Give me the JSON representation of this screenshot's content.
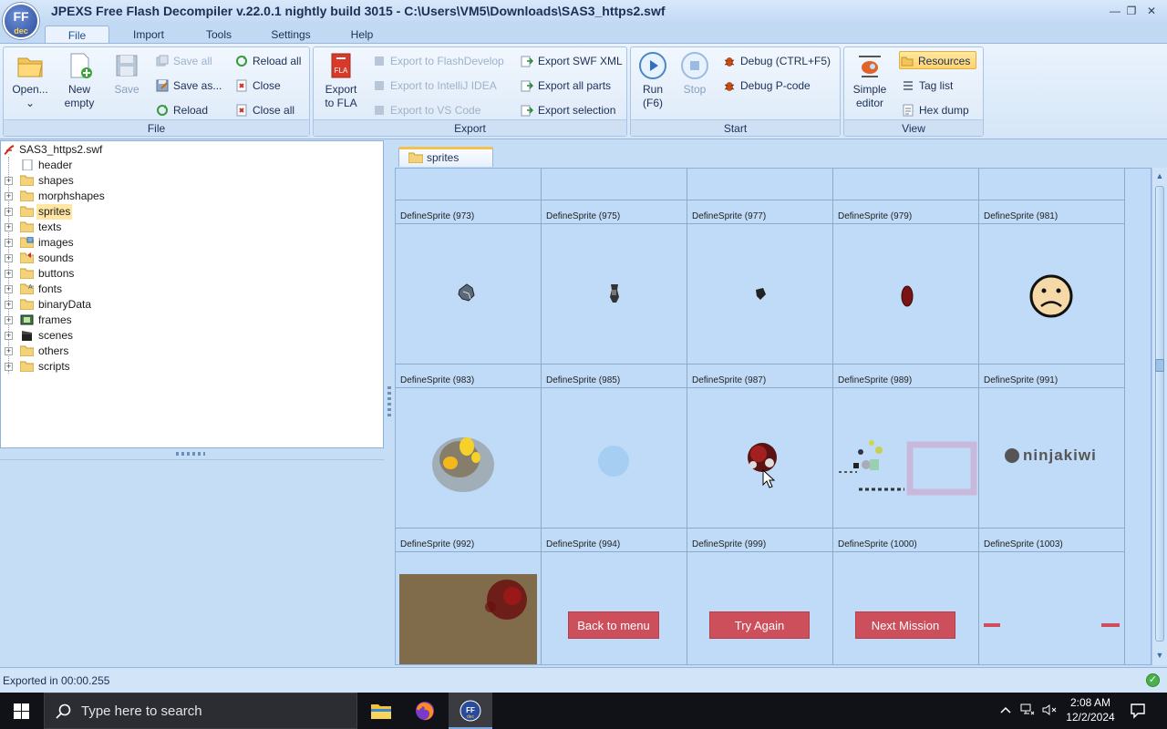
{
  "window": {
    "title": "JPEXS Free Flash Decompiler v.22.0.1 nightly build 3015 - C:\\Users\\VM5\\Downloads\\SAS3_https2.swf",
    "logo_text": "FF",
    "logo_sub": "dec"
  },
  "menu_tabs": [
    "File",
    "Import",
    "Tools",
    "Settings",
    "Help"
  ],
  "ribbon": {
    "file": {
      "label": "File",
      "open": "Open...",
      "new_line1": "New",
      "new_line2": "empty",
      "save": "Save",
      "save_all": "Save all",
      "save_as": "Save as...",
      "reload": "Reload",
      "reload_all": "Reload all",
      "close": "Close",
      "close_all": "Close all"
    },
    "export": {
      "label": "Export",
      "export_fla_line1": "Export",
      "export_fla_line2": "to FLA",
      "flashdevelop": "Export to FlashDevelop",
      "intellij": "Export to IntelliJ IDEA",
      "vscode": "Export to VS Code",
      "swf_xml": "Export SWF XML",
      "all_parts": "Export all parts",
      "selection": "Export selection"
    },
    "start": {
      "label": "Start",
      "run_line1": "Run",
      "run_line2": "(F6)",
      "stop": "Stop",
      "debug": "Debug (CTRL+F5)",
      "debug_pcode": "Debug P-code"
    },
    "view": {
      "label": "View",
      "simple_line1": "Simple",
      "simple_line2": "editor",
      "resources": "Resources",
      "tag_list": "Tag list",
      "hex_dump": "Hex dump"
    }
  },
  "tree": {
    "root": "SAS3_https2.swf",
    "items": [
      "header",
      "shapes",
      "morphshapes",
      "sprites",
      "texts",
      "images",
      "sounds",
      "buttons",
      "fonts",
      "binaryData",
      "frames",
      "scenes",
      "others",
      "scripts"
    ],
    "selected": "sprites"
  },
  "content": {
    "tab_label": "sprites",
    "rows": [
      [
        "DefineSprite (973)",
        "DefineSprite (975)",
        "DefineSprite (977)",
        "DefineSprite (979)",
        "DefineSprite (981)"
      ],
      [
        "DefineSprite (983)",
        "DefineSprite (985)",
        "DefineSprite (987)",
        "DefineSprite (989)",
        "DefineSprite (991)"
      ],
      [
        "DefineSprite (992)",
        "DefineSprite (994)",
        "DefineSprite (999)",
        "DefineSprite (1000)",
        "DefineSprite (1003)"
      ]
    ],
    "buttons": {
      "back": "Back to menu",
      "try_again": "Try Again",
      "next_mission": "Next Mission"
    },
    "ninjakiwi": "ninjakiwi"
  },
  "status": {
    "text": "Exported in 00:00.255"
  },
  "taskbar": {
    "search_placeholder": "Type here to search",
    "time": "2:08 AM",
    "date": "12/2/2024"
  },
  "colors": {
    "accent": "#f2c14e",
    "panel_bg": "#c5ddf5",
    "game_button": "#cd4f5b"
  }
}
